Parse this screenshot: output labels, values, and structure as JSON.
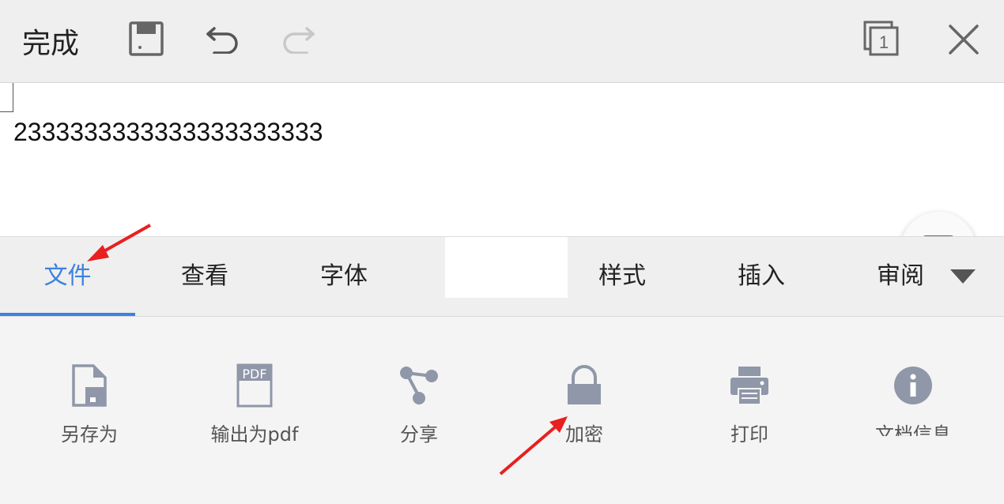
{
  "toolbar": {
    "done_label": "完成",
    "icons": [
      "save-icon",
      "undo-icon",
      "redo-icon",
      "page-count-icon",
      "close-icon"
    ],
    "page_count": "1"
  },
  "document": {
    "text": "2333333333333333333333"
  },
  "tabs": [
    {
      "label": "文件",
      "active": true
    },
    {
      "label": "查看",
      "active": false
    },
    {
      "label": "字体",
      "active": false
    },
    {
      "label": "样式",
      "active": false
    },
    {
      "label": "插入",
      "active": false
    },
    {
      "label": "审阅",
      "active": false
    }
  ],
  "file_actions": [
    {
      "label": "另存为",
      "icon": "save-as-icon"
    },
    {
      "label": "输出为pdf",
      "icon": "pdf-icon"
    },
    {
      "label": "分享",
      "icon": "share-icon"
    },
    {
      "label": "加密",
      "icon": "lock-icon"
    },
    {
      "label": "打印",
      "icon": "print-icon"
    },
    {
      "label": "文档信息",
      "icon": "info-icon"
    }
  ],
  "pdf_icon_text": "PDF",
  "colors": {
    "accent": "#3b82e0",
    "icon_gray": "#8f97a8",
    "annotation_arrow": "#e8201f"
  }
}
